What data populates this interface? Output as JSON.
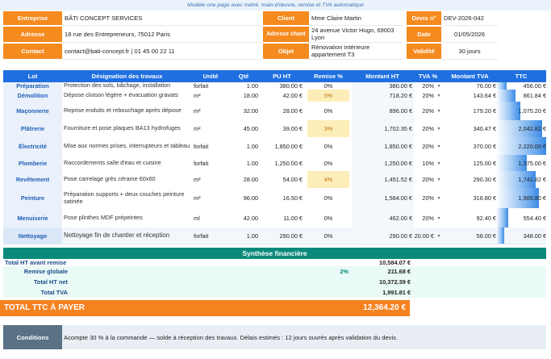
{
  "banner": "Modèle one page avec métré, main-d'œuvre, remise et TVA automatique",
  "header": {
    "entreprise_label": "Entreprise",
    "entreprise_value": "BÂTI CONCEPT SERVICES",
    "adresse_label": "Adresse",
    "adresse_value": "18 rue des Entrepreneurs, 75012 Paris",
    "contact_label": "Contact",
    "contact_value": "contact@bati-concept.fr | 01 45 00 22 11",
    "client_label": "Client",
    "client_value": "Mme Claire Martin",
    "adresse_chantier_label": "Adresse chant",
    "adresse_chantier_value": "24 avenue Victor Hugo, 69003 Lyon",
    "objet_label": "Objet",
    "objet_value": "Rénovation intérieure appartement T3",
    "devis_label": "Devis n°",
    "devis_value": "DEV-2026-042",
    "date_label": "Date",
    "date_value": "01/05/2026",
    "validite_label": "Validité",
    "validite_value": "30 jours"
  },
  "table": {
    "headers": [
      "Lot",
      "Désignation des travaux",
      "Unité",
      "Qté",
      "PU HT",
      "Remise %",
      "Montant HT",
      "TVA %",
      "Montant TVA",
      "TTC"
    ],
    "rows": [
      {
        "lot": "Préparation",
        "designation": "Protection des sols, bâchage, installation",
        "unite": "forfait",
        "qte": "1.00",
        "pu": "380.00 €",
        "remise": "0%",
        "montant_ht": "380.00 €",
        "tva": "20%",
        "montant_tva": "76.00 €",
        "ttc": "456.00 €",
        "ttc_value": 456.0,
        "highlight": false
      },
      {
        "lot": "Démolition",
        "designation": "Dépose cloison légère + évacuation gravats",
        "unite": "m²",
        "qte": "18.00",
        "pu": "42.00 €",
        "remise": "5%",
        "montant_ht": "718.20 €",
        "tva": "20%",
        "montant_tva": "143.64 €",
        "ttc": "861.84 €",
        "ttc_value": 861.84,
        "highlight": true
      },
      {
        "lot": "Maçonnerie",
        "designation": "Reprise enduits et rebouchage après dépose",
        "unite": "m²",
        "qte": "32.00",
        "pu": "28.00 €",
        "remise": "0%",
        "montant_ht": "896.00 €",
        "tva": "20%",
        "montant_tva": "179.20 €",
        "ttc": "1,075.20 €",
        "ttc_value": 1075.2,
        "highlight": false
      },
      {
        "lot": "Plâtrerie",
        "designation": "Fourniture et pose plaques BA13 hydrofuges",
        "unite": "m²",
        "qte": "45.00",
        "pu": "39.00 €",
        "remise": "3%",
        "montant_ht": "1,702.35 €",
        "tva": "20%",
        "montant_tva": "340.47 €",
        "ttc": "2,042.82 €",
        "ttc_value": 2042.82,
        "highlight": true
      },
      {
        "lot": "Électricité",
        "designation": "Mise aux normes prises, interrupteurs et tableau",
        "unite": "forfait",
        "qte": "1.00",
        "pu": "1,850.00 €",
        "remise": "0%",
        "montant_ht": "1,850.00 €",
        "tva": "20%",
        "montant_tva": "370.00 €",
        "ttc": "2,220.00 €",
        "ttc_value": 2220.0,
        "highlight": false
      },
      {
        "lot": "Plomberie",
        "designation": "Raccordements salle d'eau et cuisine",
        "unite": "forfait",
        "qte": "1.00",
        "pu": "1,250.00 €",
        "remise": "0%",
        "montant_ht": "1,250.00 €",
        "tva": "10%",
        "montant_tva": "125.00 €",
        "ttc": "1,375.00 €",
        "ttc_value": 1375.0,
        "highlight": false
      },
      {
        "lot": "Revêtement",
        "designation": "Pose carrelage grès cérame 60x60",
        "unite": "m²",
        "qte": "28.00",
        "pu": "54.00 €",
        "remise": "4%",
        "montant_ht": "1,451.52 €",
        "tva": "20%",
        "montant_tva": "290.30 €",
        "ttc": "1,741.82 €",
        "ttc_value": 1741.82,
        "highlight": true
      },
      {
        "lot": "Peinture",
        "designation": "Préparation supports + deux couches peinture satinée",
        "unite": "m²",
        "qte": "96.00",
        "pu": "16.50 €",
        "remise": "0%",
        "montant_ht": "1,584.00 €",
        "tva": "20%",
        "montant_tva": "316.80 €",
        "ttc": "1,900.80 €",
        "ttc_value": 1900.8,
        "highlight": false
      },
      {
        "lot": "Menuiserie",
        "designation": "Pose plinthes MDF prépeintes",
        "unite": "ml",
        "qte": "42.00",
        "pu": "11.00 €",
        "remise": "0%",
        "montant_ht": "462.00 €",
        "tva": "20%",
        "montant_tva": "92.40 €",
        "ttc": "554.40 €",
        "ttc_value": 554.4,
        "highlight": false
      },
      {
        "lot": "Nettoyage",
        "designation": "Nettoyage fin de chantier et réception",
        "unite": "forfait",
        "qte": "1.00",
        "pu": "290.00 €",
        "remise": "0%",
        "montant_ht": "290.00 €",
        "tva": "20.00 €",
        "montant_tva": "58.00 €",
        "ttc": "348.00 €",
        "ttc_value": 348.0,
        "highlight": false
      }
    ]
  },
  "synthese": {
    "title": "Synthèse financière",
    "total_ht_avant_remise_label": "Total HT avant remise",
    "total_ht_avant_remise_value": "10,584.07 €",
    "remise_globale_label": "Remise globale",
    "remise_globale_pct": "2%",
    "remise_globale_value": "211.68 €",
    "total_ht_net_label": "Total HT net",
    "total_ht_net_value": "10,372.39 €",
    "total_tva_label": "Total TVA",
    "total_tva_value": "1,991.81 €",
    "total_ttc_label": "TOTAL TTC À PAYER",
    "total_ttc_value": "12,364.20 €"
  },
  "conditions": {
    "label": "Conditions",
    "text": "Acompte 30 % à la commande — solde à réception des travaux. Délais estimés : 12 jours ouvrés après validation du devis."
  }
}
